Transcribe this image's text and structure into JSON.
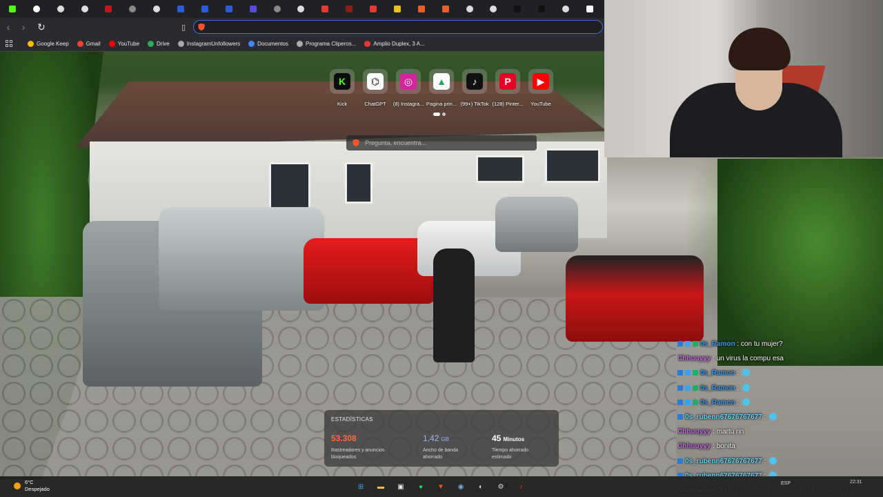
{
  "browser": {
    "tabs": [
      {
        "color": "#53fc18",
        "icon": "kick-icon"
      },
      {
        "color": "#ffffff",
        "icon": "globe-icon"
      },
      {
        "color": "#dddddd",
        "icon": "chrome-icon"
      },
      {
        "color": "#dddddd",
        "icon": "chrome-icon"
      },
      {
        "color": "#c4161c",
        "icon": "youtube-icon"
      },
      {
        "color": "#888888",
        "icon": "globe-icon"
      },
      {
        "color": "#dddddd",
        "icon": "chrome-icon"
      },
      {
        "color": "#2b5cd6",
        "icon": "doc-icon"
      },
      {
        "color": "#2b5cd6",
        "icon": "doc-icon"
      },
      {
        "color": "#2b5cd6",
        "icon": "doc-icon"
      },
      {
        "color": "#5a4ad6",
        "icon": "azure-icon"
      },
      {
        "color": "#888888",
        "icon": "globe-icon"
      },
      {
        "color": "#dddddd",
        "icon": "chrome-icon"
      },
      {
        "color": "#e53935",
        "icon": "brave-icon"
      },
      {
        "color": "#8a1c1c",
        "icon": "site-icon"
      },
      {
        "color": "#e53935",
        "icon": "brave-icon"
      },
      {
        "color": "#e8c21a",
        "icon": "site-icon"
      },
      {
        "color": "#e5602a",
        "icon": "site-icon"
      },
      {
        "color": "#e5602a",
        "icon": "site-icon"
      },
      {
        "color": "#dddddd",
        "icon": "chrome-icon"
      },
      {
        "color": "#dddddd",
        "icon": "chrome-icon"
      },
      {
        "color": "#111111",
        "icon": "tiktok-icon"
      },
      {
        "color": "#111111",
        "icon": "tiktok-icon"
      },
      {
        "color": "#dddddd",
        "icon": "chrome-icon"
      },
      {
        "color": "#ffffff",
        "icon": "wikipedia-icon"
      }
    ],
    "bookmarks": [
      {
        "label": "Google Keep",
        "color": "#f9bc05"
      },
      {
        "label": "Gmail",
        "color": "#ea4335"
      },
      {
        "label": "YouTube",
        "color": "#ff0000"
      },
      {
        "label": "Drive",
        "color": "#34a853"
      },
      {
        "label": "InstagramUnfollowers",
        "color": "#aaaaaa"
      },
      {
        "label": "Documentos",
        "color": "#4285f4"
      },
      {
        "label": "Programa Cliperos...",
        "color": "#aaaaaa"
      },
      {
        "label": "Amplio Duplex, 3 A...",
        "color": "#e53935"
      }
    ]
  },
  "newtab": {
    "shortcuts": [
      {
        "label": "Kick",
        "glyph": "K",
        "bg": "#0b0b0b",
        "fg": "#53fc18"
      },
      {
        "label": "ChatGPT",
        "glyph": "⌬",
        "bg": "#ffffff",
        "fg": "#111111"
      },
      {
        "label": "(8) Instagra...",
        "glyph": "◎",
        "bg": "#d6249f",
        "fg": "#ffffff"
      },
      {
        "label": "Pagina prin...",
        "glyph": "▲",
        "bg": "#ffffff",
        "fg": "#1fa463"
      },
      {
        "label": "(99+) TikTok",
        "glyph": "♪",
        "bg": "#111111",
        "fg": "#ffffff"
      },
      {
        "label": "(128) Pinter...",
        "glyph": "P",
        "bg": "#e60023",
        "fg": "#ffffff"
      },
      {
        "label": "YouTube",
        "glyph": "▶",
        "bg": "#ff0000",
        "fg": "#ffffff"
      }
    ],
    "search_placeholder": "Pregunta, encuentra...",
    "stats": {
      "title": "ESTADÍSTICAS",
      "items": [
        {
          "value": "53.308",
          "unit": "",
          "desc": "Rastreadores y anuncios bloqueados",
          "color": "#ff6a3d"
        },
        {
          "value": "1,42",
          "unit": "GB",
          "desc": "Ancho de banda ahorrado",
          "color": "#9fb8ff"
        },
        {
          "value": "45",
          "unit": "Minutos",
          "desc": "Tiempo ahorrado estimado",
          "color": "#ffffff"
        }
      ]
    }
  },
  "chat": [
    {
      "user": "0s_Ramon",
      "text": "con tu mujer?",
      "color": "#3b9df0",
      "badges": 3
    },
    {
      "user": "Chhuuyyy",
      "text": "un virus la compu esa",
      "color": "#c86be6",
      "badges": 0
    },
    {
      "user": "0s_Ramon",
      "text": "",
      "color": "#3b9df0",
      "badges": 3,
      "emote": true
    },
    {
      "user": "0s_Ramon",
      "text": "",
      "color": "#3b9df0",
      "badges": 3,
      "emote": true
    },
    {
      "user": "0s_Ramon",
      "text": "",
      "color": "#3b9df0",
      "badges": 3,
      "emote": true
    },
    {
      "user": "0s_rubenn67676767677",
      "text": "",
      "color": "#6bd6ff",
      "badges": 1,
      "emote": true
    },
    {
      "user": "Chhuuyyy",
      "text": "martu rin",
      "color": "#c86be6",
      "badges": 0
    },
    {
      "user": "Chhuuyyy",
      "text": "bonita",
      "color": "#c86be6",
      "badges": 0
    },
    {
      "user": "0s_rubenn67676767677",
      "text": "",
      "color": "#6bd6ff",
      "badges": 1,
      "emote": true
    },
    {
      "user": "0s_rubenn67676767677",
      "text": "",
      "color": "#6bd6ff",
      "badges": 1,
      "emote": true
    },
    {
      "user": "ShadowsadOG",
      "text": "No no,hay que buscarlo en youtube bro",
      "color": "#ffffff",
      "badges": 0
    }
  ],
  "taskbar": {
    "temp": "6°C",
    "condition": "Despejado",
    "apps": [
      {
        "name": "windows-start-icon",
        "glyph": "⊞",
        "color": "#3aa0ff"
      },
      {
        "name": "file-explorer-icon",
        "glyph": "▬",
        "color": "#f5c242"
      },
      {
        "name": "store-icon",
        "glyph": "▣",
        "color": "#e8e8e8"
      },
      {
        "name": "spotify-icon",
        "glyph": "●",
        "color": "#1ed760"
      },
      {
        "name": "brave-icon",
        "glyph": "▼",
        "color": "#fb542b"
      },
      {
        "name": "steam-icon",
        "glyph": "◉",
        "color": "#6fa8dc"
      },
      {
        "name": "app-icon",
        "glyph": "◐",
        "color": "#dddddd"
      },
      {
        "name": "settings-icon",
        "glyph": "⚙",
        "color": "#dddddd"
      },
      {
        "name": "tiktok-icon",
        "glyph": "♪",
        "color": "#ff2d6a"
      }
    ],
    "lang": "ESP",
    "time": "22:31"
  }
}
